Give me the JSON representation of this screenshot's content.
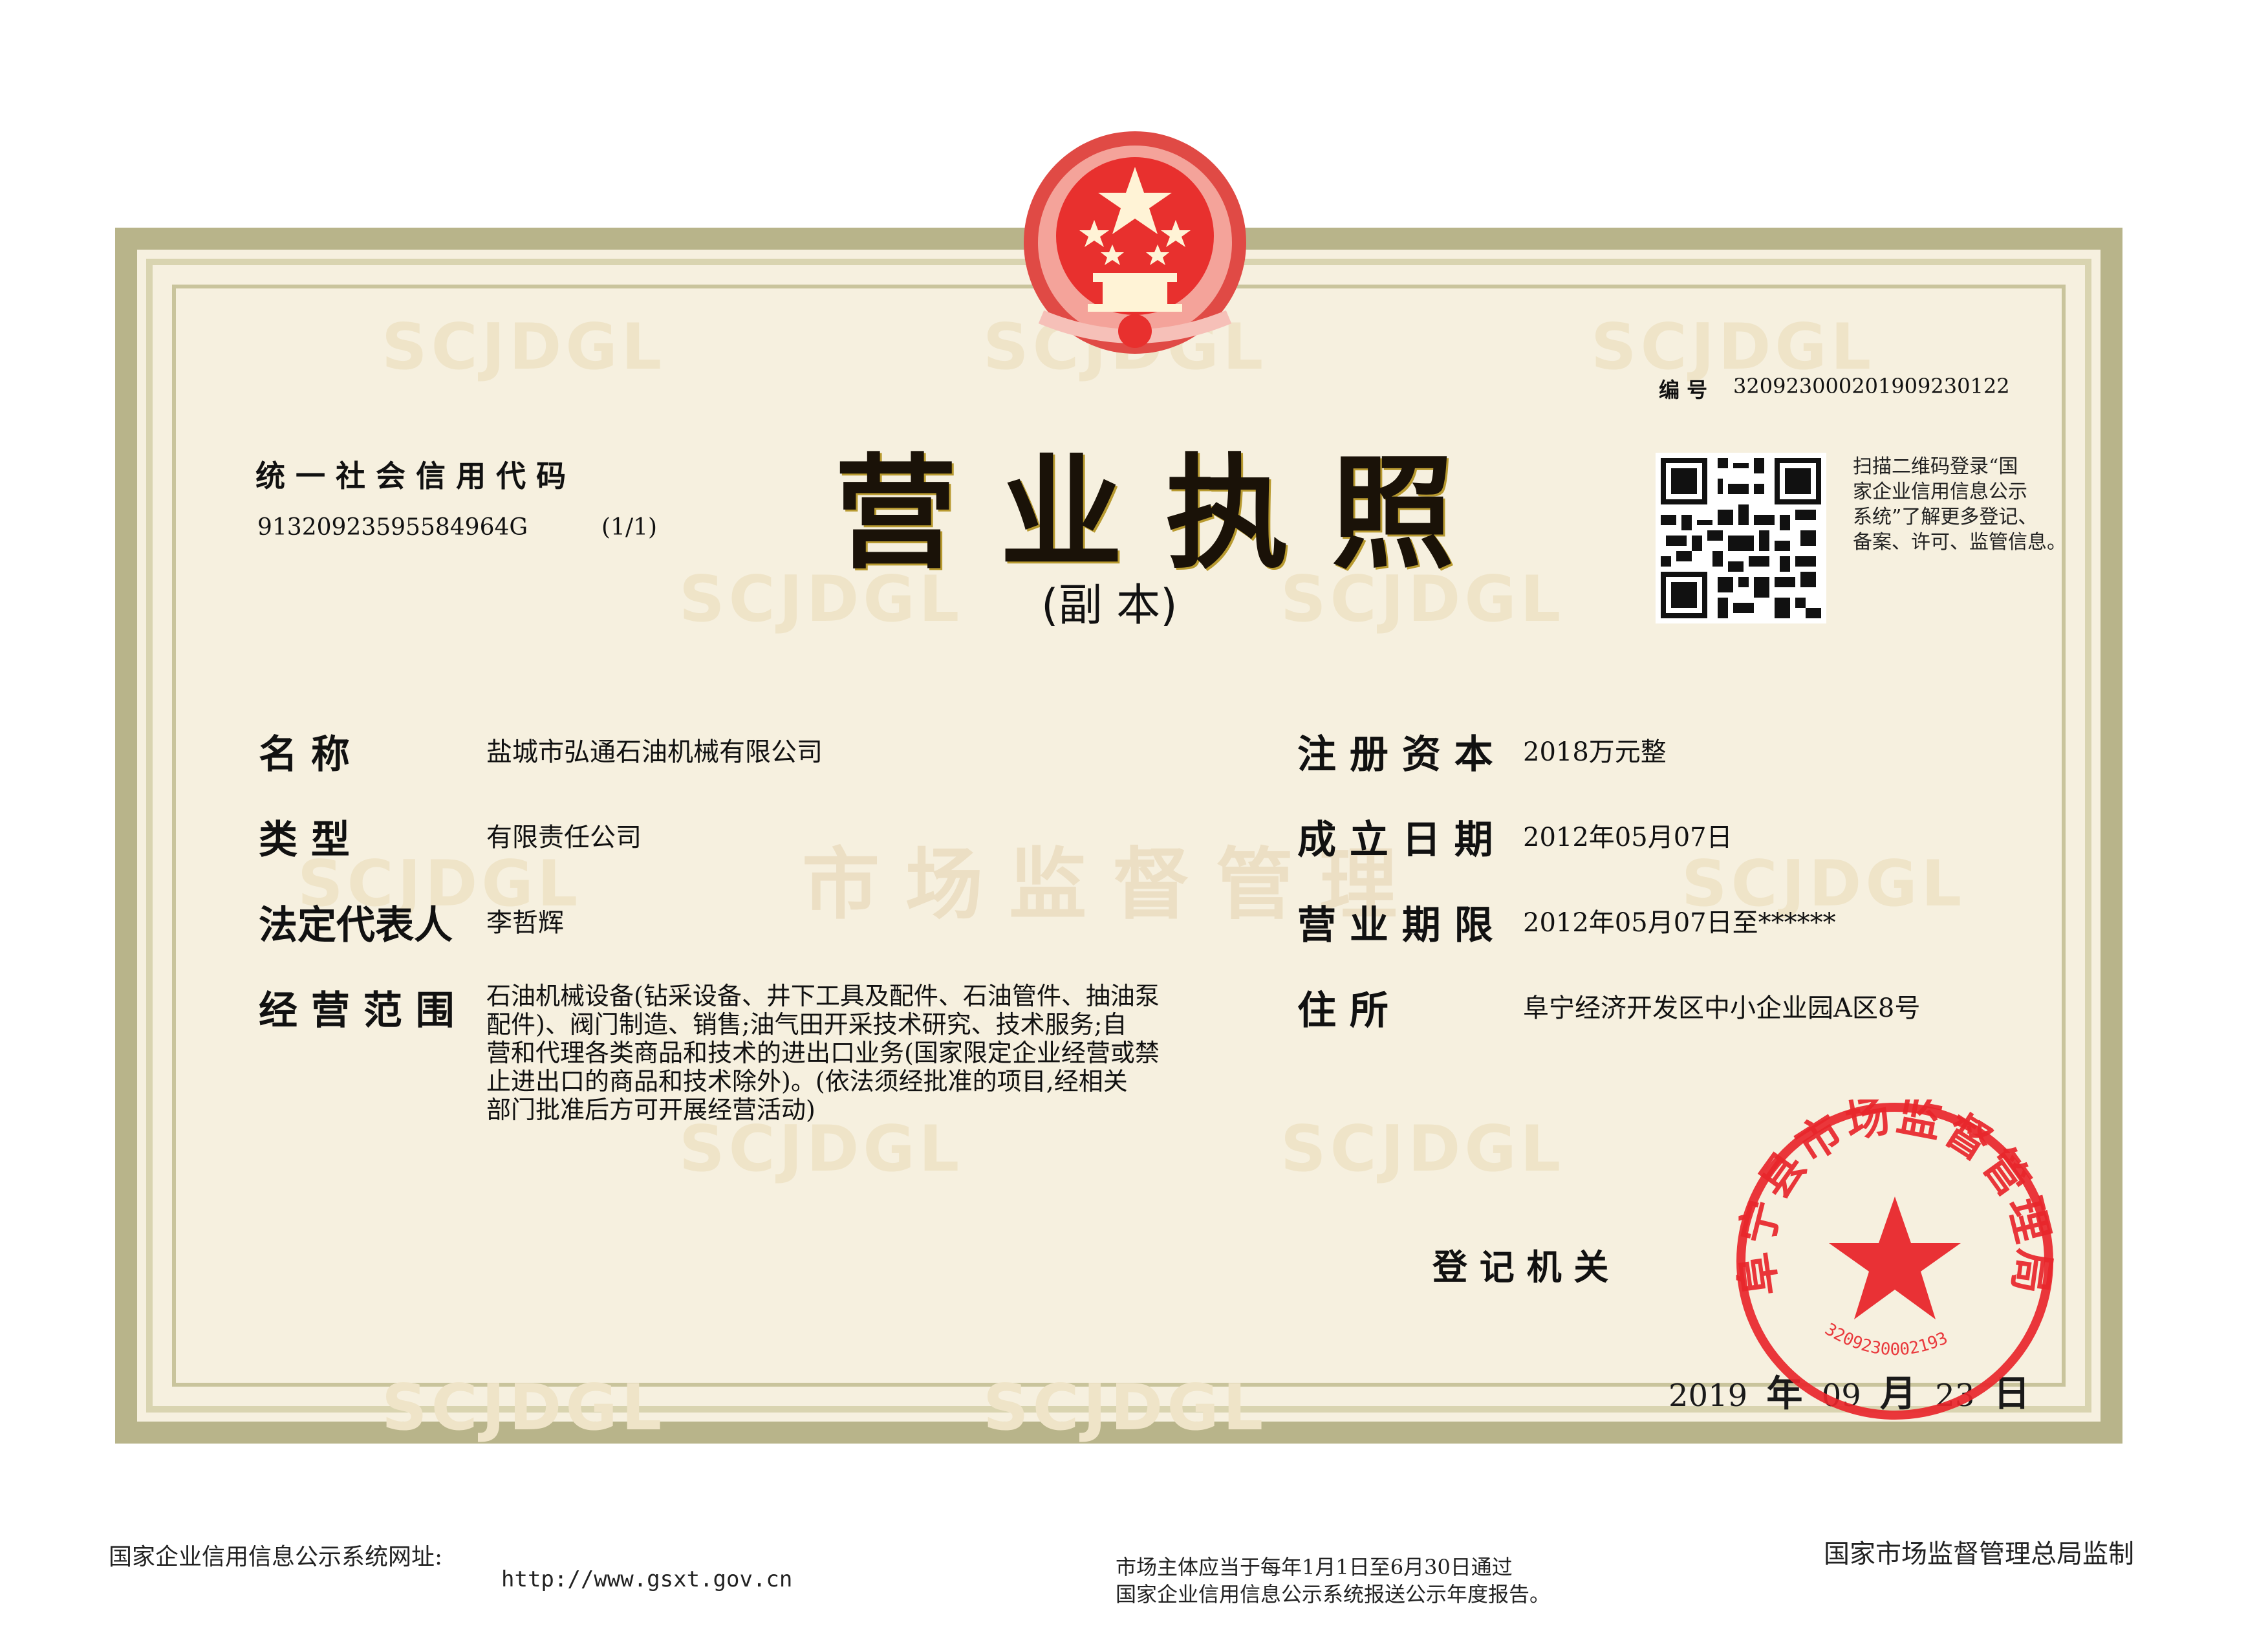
{
  "header": {
    "credit_code_label": "统 一 社 会 信 用 代 码",
    "credit_code": "91320923595584964G",
    "copy_index": "(1/1)",
    "title": "营 业 执 照",
    "subtitle": "(副  本)",
    "serial_label": "编 号",
    "serial_number": "320923000201909230122",
    "qr_note_lines": [
      "扫描二维码登录“国",
      "家企业信用信息公示",
      "系统”了解更多登记、",
      "备案、许可、监管信息。"
    ]
  },
  "fields": {
    "name_label": "名        称",
    "name": "盐城市弘通石油机械有限公司",
    "type_label": "类        型",
    "type": "有限责任公司",
    "rep_label": "法定代表人",
    "rep": "李哲辉",
    "scope_label": "经 营 范 围",
    "scope_lines": [
      "石油机械设备(钻采设备、井下工具及配件、石油管件、抽油泵",
      "配件)、阀门制造、销售;油气田开采技术研究、技术服务;自",
      "营和代理各类商品和技术的进出口业务(国家限定企业经营或禁",
      "止进出口的商品和技术除外)。(依法须经批准的项目,经相关",
      "部门批准后方可开展经营活动)"
    ],
    "capital_label": "注 册 资 本",
    "capital": "2018万元整",
    "founded_label": "成 立 日 期",
    "founded": "2012年05月07日",
    "term_label": "营 业 期 限",
    "term": "2012年05月07日至******",
    "address_label": "住        所",
    "address": "阜宁经济开发区中小企业园A区8号"
  },
  "issuer": {
    "label": "登 记 机 关",
    "year": "2019",
    "year_unit": "年",
    "month": "09",
    "month_unit": "月",
    "day": "23",
    "day_unit": "日",
    "seal_text": "阜宁县市场监督管理局",
    "seal_code": "3209230002193"
  },
  "watermarks": {
    "latin": "SCJDGL",
    "chinese": "市场监督管理"
  },
  "footer": {
    "site_label": "国家企业信用信息公示系统网址:",
    "site_url": "http://www.gsxt.gov.cn",
    "notice_line1": "市场主体应当于每年1月1日至6月30日通过",
    "notice_line2": "国家企业信用信息公示系统报送公示年度报告。",
    "supervisor": "国家市场监督管理总局监制"
  },
  "colors": {
    "seal_red": "#e8262b",
    "emblem_red": "#d9252b",
    "title_gold": "#1a1208"
  }
}
